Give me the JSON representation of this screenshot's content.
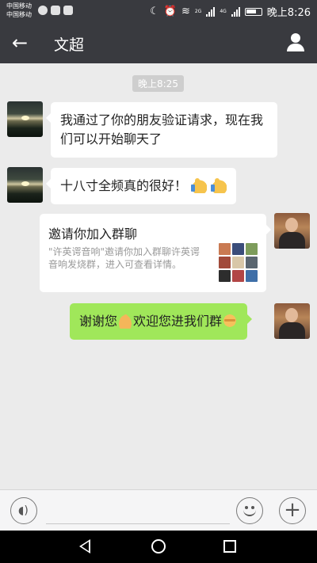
{
  "statusbar": {
    "carrier1": "中国移动",
    "carrier2": "中国移动",
    "network1": "2G",
    "network2": "4G",
    "time": "晚上8:26"
  },
  "header": {
    "title": "文超"
  },
  "chat": {
    "timestamp": "晚上8:25",
    "messages": [
      {
        "side": "left",
        "text": "我通过了你的朋友验证请求，现在我们可以开始聊天了"
      },
      {
        "side": "left",
        "text": "十八寸全频真的很好！"
      },
      {
        "side": "right",
        "type": "invite",
        "title": "邀请你加入群聊",
        "desc": "\"许英谔音响\"邀请你加入群聊许英谔音响发烧群，进入可查看详情。"
      },
      {
        "side": "right",
        "text_part1": "谢谢您",
        "text_part2": "欢迎您进我们群"
      }
    ]
  },
  "inputbar": {
    "text_value": ""
  },
  "colors": {
    "bar": "#393a3f",
    "chat_bg": "#ebebeb",
    "bubble_sent": "#a0e75a"
  }
}
